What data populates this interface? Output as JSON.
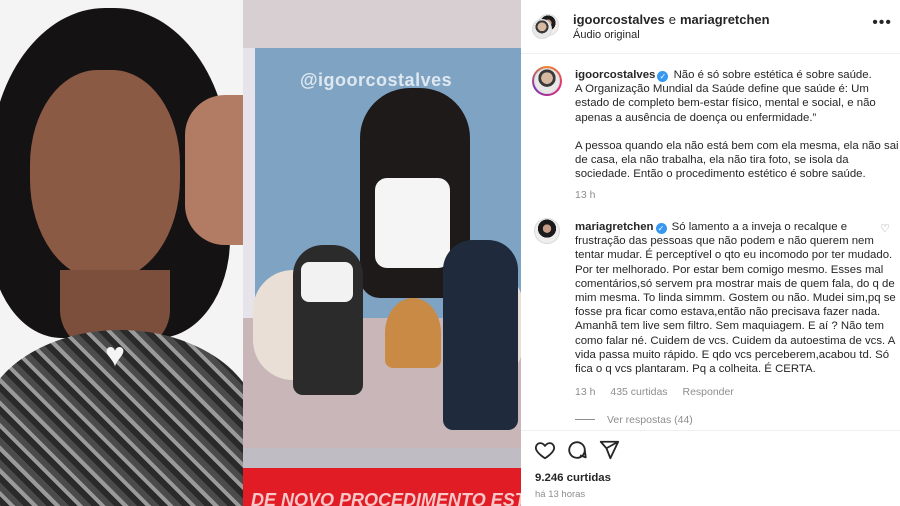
{
  "video": {
    "watermark": "@igoorcostalves",
    "banner_text": "DE NOVO PROCEDIMENTO ESTÉTI"
  },
  "header": {
    "user1": "igoorcostalves",
    "connector": "e",
    "user2": "mariagretchen",
    "subtitle": "Áudio original",
    "more_icon": "more-horizontal-icon"
  },
  "post": {
    "username": "igoorcostalves",
    "lines": [
      "Não é só sobre estética é sobre saúde.",
      "A Organização Mundial da Saúde define que saúde é: Um estado de completo bem-estar físico, mental e social, e não apenas a ausência de doença ou enfermidade.”",
      "A pessoa quando ela não está bem com ela mesma, ela não sai de casa, ela não trabalha, ela não tira foto, se isola da sociedade. Então o procedimento estético é sobre saúde."
    ],
    "time": "13 h"
  },
  "comment": {
    "username": "mariagretchen",
    "text": "Só lamento a a inveja o recalque e frustração das pessoas que não podem e não querem nem tentar mudar. É perceptível o qto eu incomodo por ter mudado. Por ter melhorado. Por estar bem comigo mesmo. Esses mal comentários,só servem pra mostrar mais de quem fala, do q de mim mesma. To linda simmm. Gostem ou não. Mudei sim,pq se fosse pra ficar como estava,então não precisava fazer nada. Amanhã tem live sem filtro. Sem maquiagem. E aí ? Não tem como falar né. Cuidem de vcs. Cuidem da autoestima de vcs. A vida passa muito rápido. E qdo vcs perceberem,acabou td. Só fica o q vcs plantaram. Pq a colheita. É CERTA.",
    "time": "13 h",
    "likes": "435 curtidas",
    "reply": "Responder",
    "view_replies": "Ver respostas (44)"
  },
  "actions": {
    "icons": [
      "heart-icon",
      "comment-icon",
      "share-icon"
    ],
    "likes": "9.246 curtidas",
    "time": "há 13 horas"
  }
}
